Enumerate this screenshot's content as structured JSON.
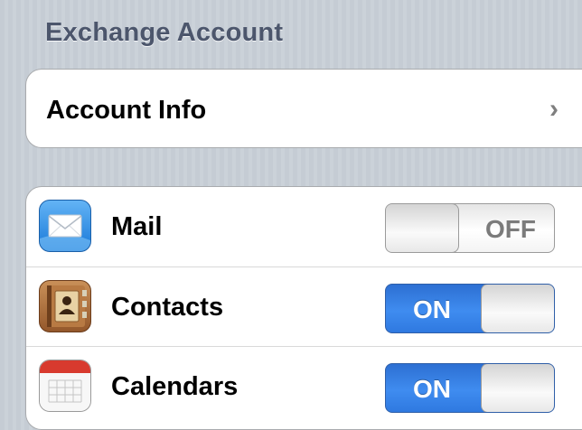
{
  "section": {
    "title": "Exchange Account"
  },
  "account_info": {
    "label": "Account Info",
    "chevron": "›",
    "icon": "chevron-right-icon"
  },
  "services": [
    {
      "label": "Mail",
      "icon": "mail-icon",
      "state": "OFF",
      "enabled": false
    },
    {
      "label": "Contacts",
      "icon": "contacts-icon",
      "state": "ON",
      "enabled": true
    },
    {
      "label": "Calendars",
      "icon": "calendar-icon",
      "state": "ON",
      "enabled": true
    }
  ],
  "colors": {
    "background": "#c5ccd4",
    "header_text": "#4c566c",
    "toggle_on": "#3f8cf0",
    "toggle_off_text": "#7b7b7b"
  }
}
